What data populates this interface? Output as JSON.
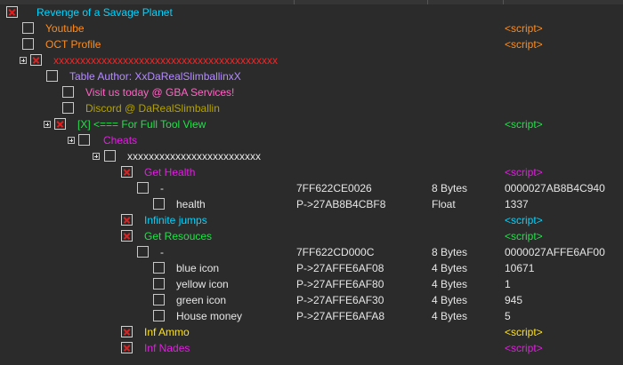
{
  "colors": {
    "cyan": "#00d5ff",
    "orange": "#ff8c1a",
    "red": "#ff2020",
    "lavender": "#b48cff",
    "pink": "#ff66c4",
    "olive": "#b3a200",
    "green": "#22e04a",
    "magenta": "#e020e0",
    "white": "#e6e6e6",
    "yellow": "#ffe21a"
  },
  "rows": [
    {
      "desc": "Revenge of a Savage Planet",
      "checked": true,
      "expander": false,
      "color": "cyan",
      "value": ""
    },
    {
      "desc": "Youtube",
      "checked": false,
      "expander": false,
      "color": "orange",
      "value": "<script>"
    },
    {
      "desc": "OCT Profile",
      "checked": false,
      "expander": false,
      "color": "orange",
      "value": "<script>"
    },
    {
      "desc": "xxxxxxxxxxxxxxxxxxxxxxxxxxxxxxxxxxxxxxxxxx",
      "checked": true,
      "expander": true,
      "color": "red",
      "value": ""
    },
    {
      "desc": "Table Author:  XxDaRealSlimballinxX",
      "checked": false,
      "expander": false,
      "color": "lavender",
      "value": ""
    },
    {
      "desc": "Visit us today @ GBA Services!",
      "checked": false,
      "expander": false,
      "color": "pink",
      "value": ""
    },
    {
      "desc": "Discord  @ DaRealSlimballin",
      "checked": false,
      "expander": false,
      "color": "olive",
      "value": ""
    },
    {
      "desc": "[X] <=== For Full Tool View",
      "checked": true,
      "expander": true,
      "color": "green",
      "value": "<script>"
    },
    {
      "desc": "Cheats",
      "checked": false,
      "expander": true,
      "color": "magenta",
      "value": ""
    },
    {
      "desc": "xxxxxxxxxxxxxxxxxxxxxxxxx",
      "checked": false,
      "expander": true,
      "color": "white",
      "value": ""
    },
    {
      "desc": "Get Health",
      "checked": true,
      "expander": false,
      "color": "magenta",
      "value": "<script>"
    },
    {
      "desc": "-",
      "checked": false,
      "expander": false,
      "color": "white",
      "address": "7FF622CE0026",
      "type": "8 Bytes",
      "value": "0000027AB8B4C940"
    },
    {
      "desc": "health",
      "checked": false,
      "expander": false,
      "color": "white",
      "address": "P->27AB8B4CBF8",
      "type": "Float",
      "value": "1337"
    },
    {
      "desc": "Infinite jumps",
      "checked": true,
      "expander": false,
      "color": "cyan",
      "value": "<script>"
    },
    {
      "desc": "Get Resouces",
      "checked": true,
      "expander": false,
      "color": "green",
      "value": "<script>"
    },
    {
      "desc": "-",
      "checked": false,
      "expander": false,
      "color": "white",
      "address": "7FF622CD000C",
      "type": "8 Bytes",
      "value": "0000027AFFE6AF00"
    },
    {
      "desc": "blue icon",
      "checked": false,
      "expander": false,
      "color": "white",
      "address": "P->27AFFE6AF08",
      "type": "4 Bytes",
      "value": "10671"
    },
    {
      "desc": "yellow icon",
      "checked": false,
      "expander": false,
      "color": "white",
      "address": "P->27AFFE6AF80",
      "type": "4 Bytes",
      "value": "1"
    },
    {
      "desc": "green icon",
      "checked": false,
      "expander": false,
      "color": "white",
      "address": "P->27AFFE6AF30",
      "type": "4 Bytes",
      "value": "945"
    },
    {
      "desc": "House money",
      "checked": false,
      "expander": false,
      "color": "white",
      "address": "P->27AFFE6AFA8",
      "type": "4 Bytes",
      "value": "5"
    },
    {
      "desc": "Inf Ammo",
      "checked": true,
      "expander": false,
      "color": "yellow",
      "value": "<script>"
    },
    {
      "desc": "Inf Nades",
      "checked": true,
      "expander": false,
      "color": "magenta",
      "value": "<script>"
    }
  ]
}
